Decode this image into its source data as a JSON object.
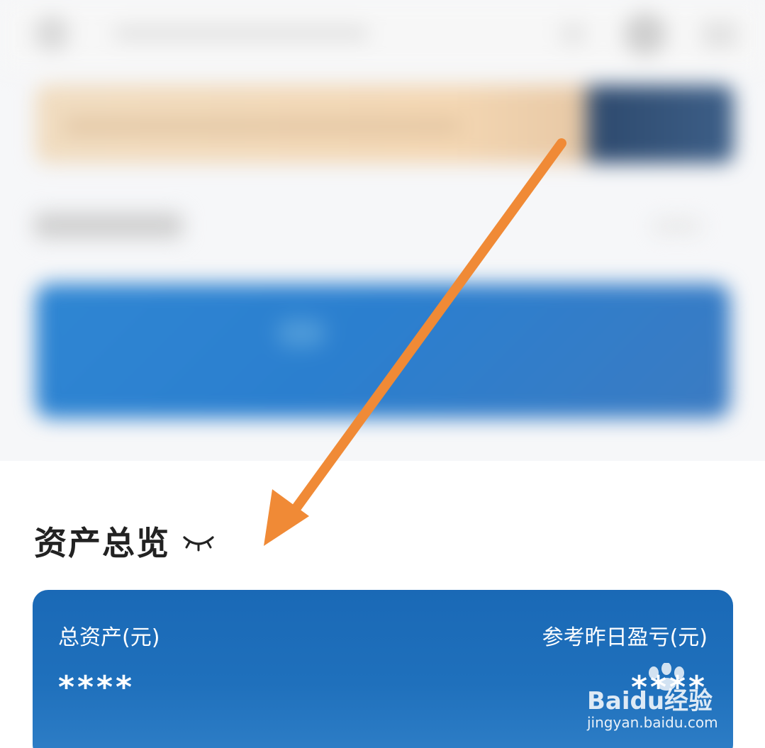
{
  "overview": {
    "title": "资产总览",
    "eye_icon": "eye-closed-icon"
  },
  "asset_card": {
    "total_assets_label": "总资产(元)",
    "total_assets_value": "****",
    "yesterday_pnl_label": "参考昨日盈亏(元)",
    "yesterday_pnl_value": "****",
    "background_color": "#1a69b6"
  },
  "annotation": {
    "arrow_color": "#f08a36"
  },
  "watermark": {
    "logo_text": "Baidu经验",
    "url": "jingyan.baidu.com"
  }
}
